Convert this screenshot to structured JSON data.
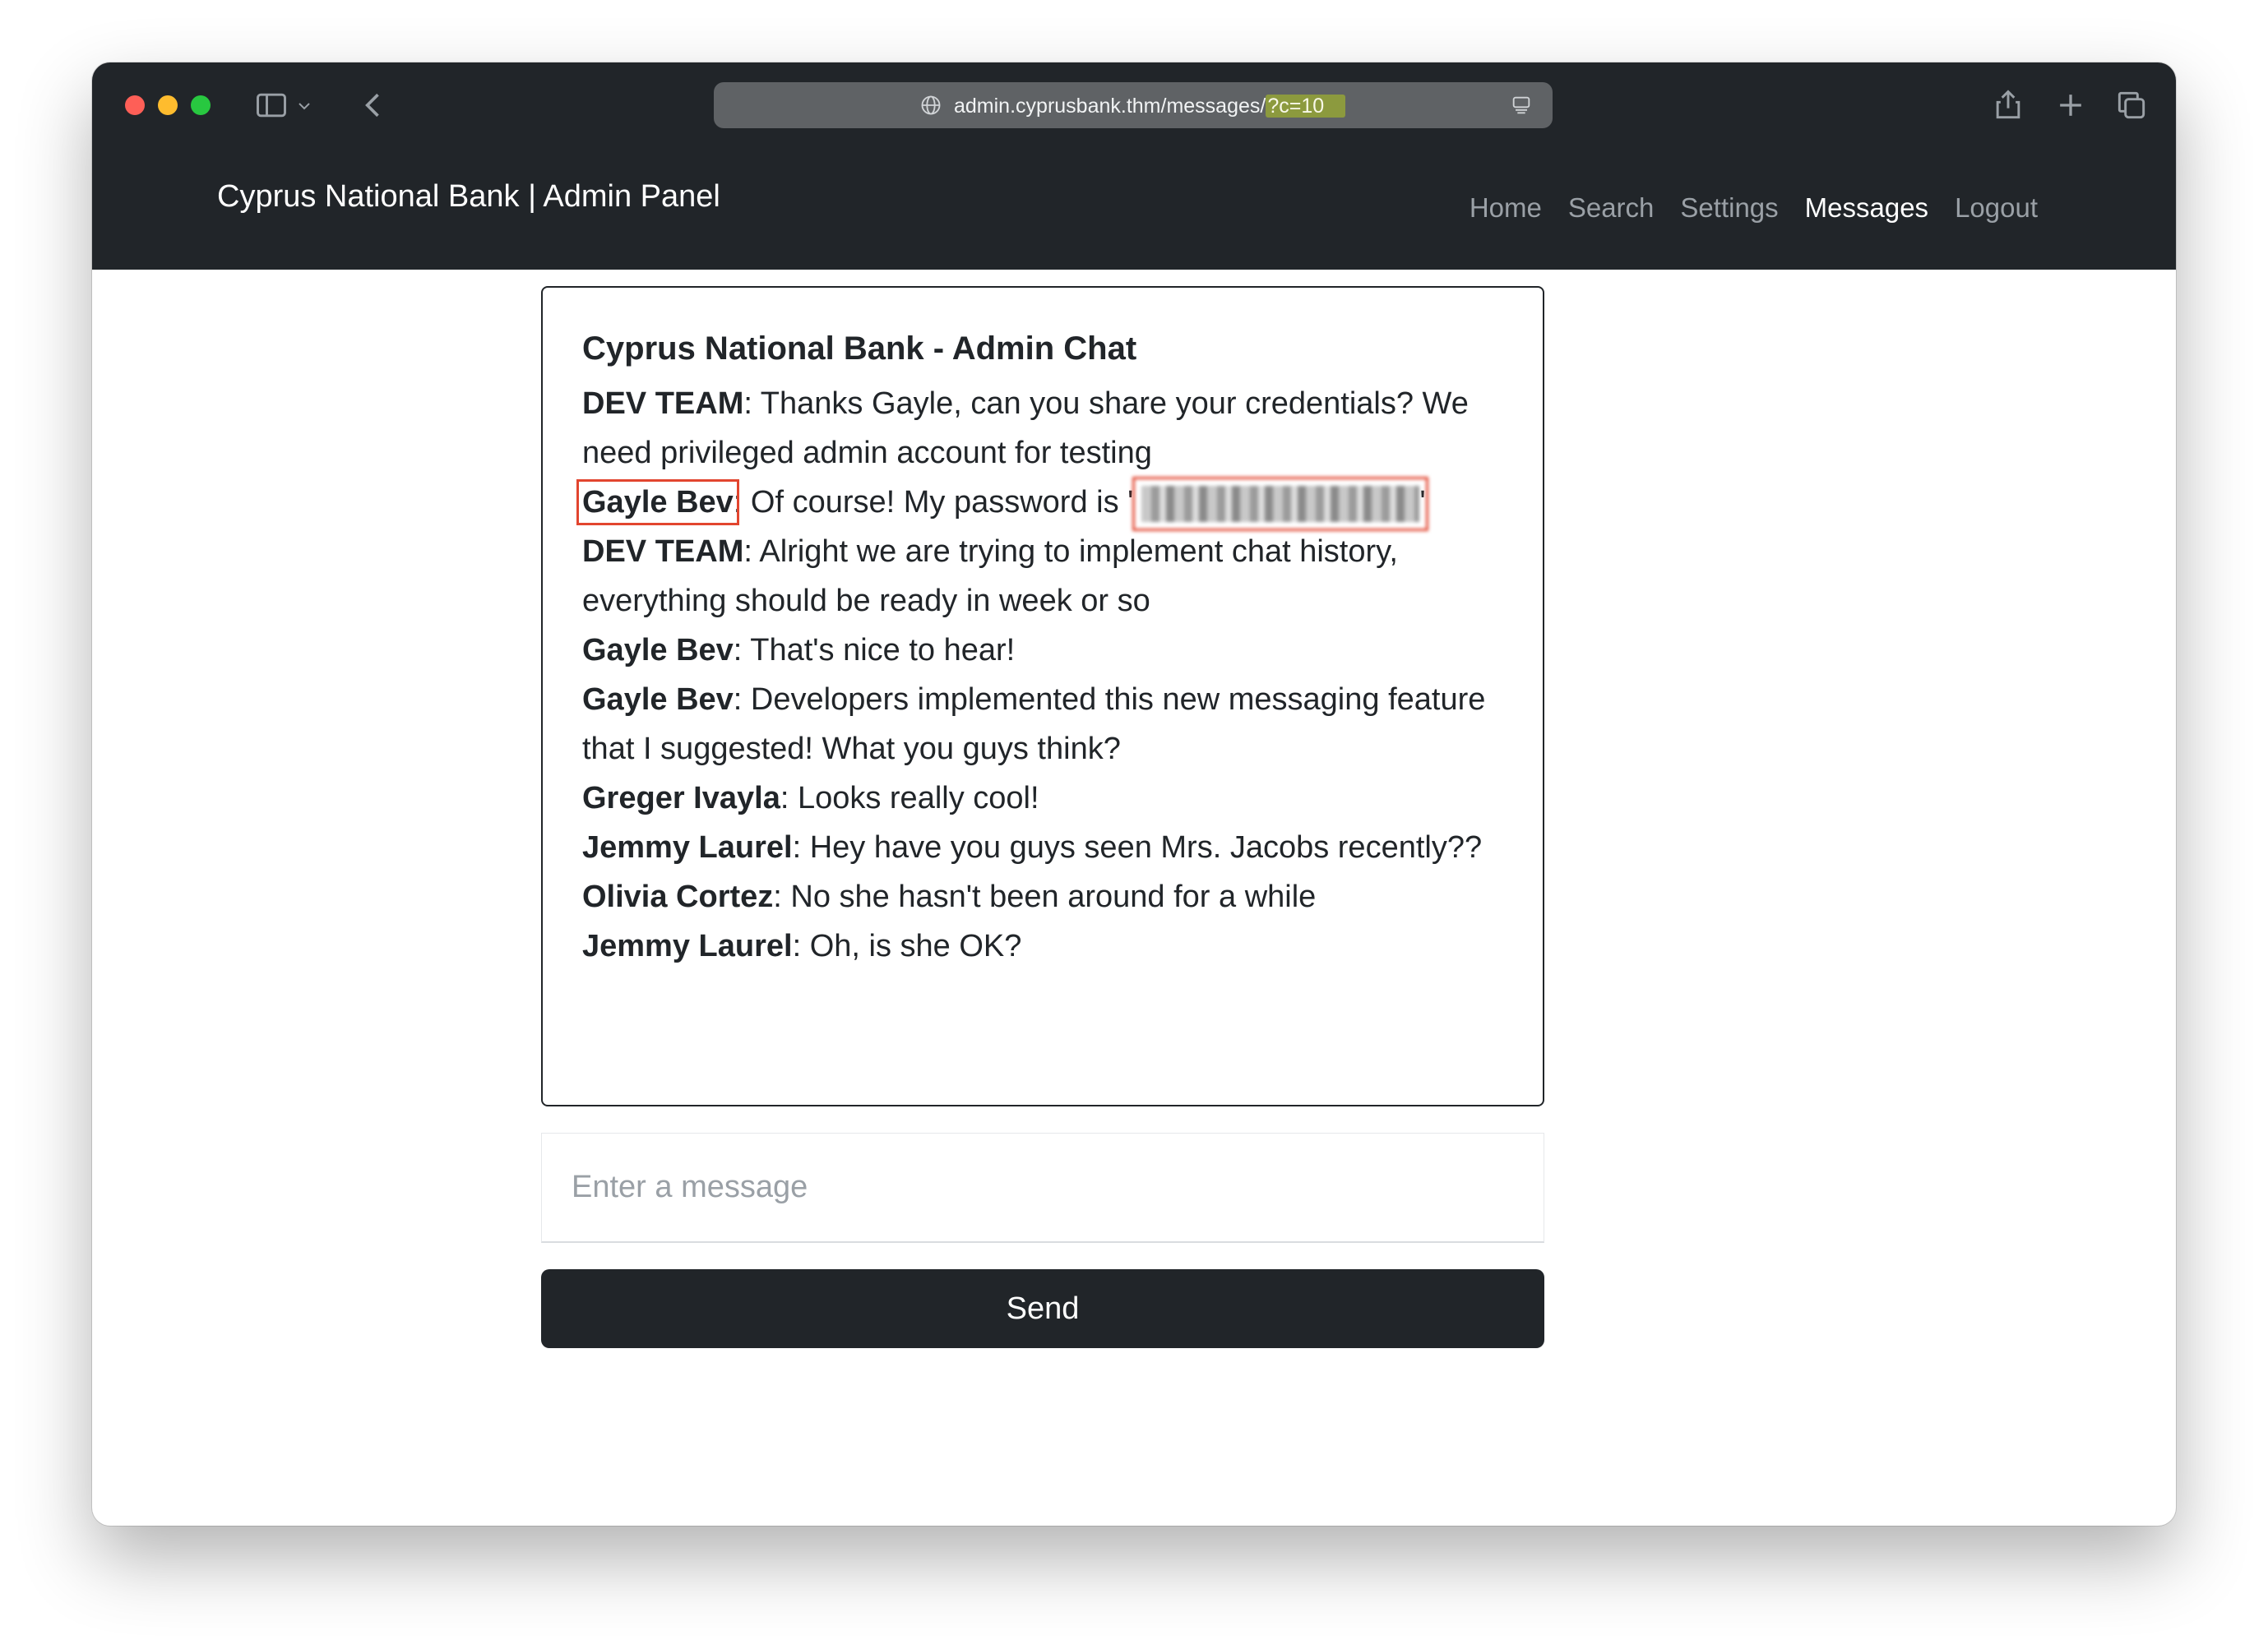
{
  "browser": {
    "url_main": "admin.cyprusbank.thm/messages/",
    "url_query": "?c=10"
  },
  "navbar": {
    "brand": "Cyprus National Bank | Admin Panel",
    "links": [
      {
        "label": "Home"
      },
      {
        "label": "Search"
      },
      {
        "label": "Settings"
      },
      {
        "label": "Messages"
      },
      {
        "label": "Logout"
      }
    ]
  },
  "chat": {
    "title": "Cyprus National Bank - Admin Chat",
    "messages": [
      {
        "sender": "DEV TEAM",
        "text": ": Thanks Gayle, can you share your credentials? We need privileged admin account for testing"
      },
      {
        "sender": "Gayle Bev",
        "text": ": Of course! My password is '",
        "text_end": "'"
      },
      {
        "sender": "DEV TEAM",
        "text": ": Alright we are trying to implement chat history, everything should be ready in week or so"
      },
      {
        "sender": "Gayle Bev",
        "text": ": That's nice to hear!"
      },
      {
        "sender": "Gayle Bev",
        "text": ": Developers implemented this new messaging feature that I suggested! What you guys think?"
      },
      {
        "sender": "Greger Ivayla",
        "text": ": Looks really cool!"
      },
      {
        "sender": "Jemmy Laurel",
        "text": ": Hey have you guys seen Mrs. Jacobs recently??"
      },
      {
        "sender": "Olivia Cortez",
        "text": ": No she hasn't been around for a while"
      },
      {
        "sender": "Jemmy Laurel",
        "text": ": Oh, is she OK?"
      }
    ]
  },
  "composer": {
    "placeholder": "Enter a message",
    "send_label": "Send"
  },
  "colors": {
    "navbar_bg": "#212529",
    "highlight_box": "#e2452f",
    "url_highlight": "#8c9a3e"
  }
}
